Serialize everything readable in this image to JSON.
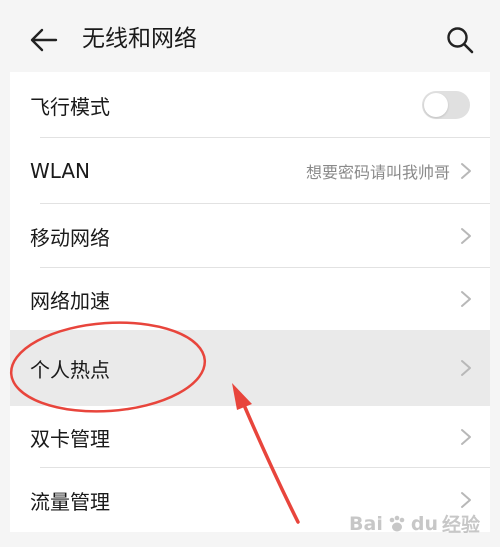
{
  "header": {
    "title": "无线和网络",
    "back_icon": "arrow-left-icon",
    "search_icon": "search-icon"
  },
  "rows": [
    {
      "label": "飞行模式",
      "control": "toggle",
      "toggle_on": false
    },
    {
      "label": "WLAN",
      "value": "想要密码请叫我帅哥",
      "control": "chevron"
    },
    {
      "label": "移动网络",
      "control": "chevron"
    },
    {
      "label": "网络加速",
      "control": "chevron"
    },
    {
      "label": "个人热点",
      "control": "chevron",
      "highlighted": true
    },
    {
      "label": "双卡管理",
      "control": "chevron"
    },
    {
      "label": "流量管理",
      "control": "chevron"
    }
  ],
  "watermark": {
    "brand": "Bai",
    "brand2": "du",
    "suffix": "经验"
  },
  "colors": {
    "annotation_red": "#e8453c",
    "background": "#f5f5f5",
    "row_bg": "#ffffff",
    "secondary_text": "#8a8a8a"
  }
}
